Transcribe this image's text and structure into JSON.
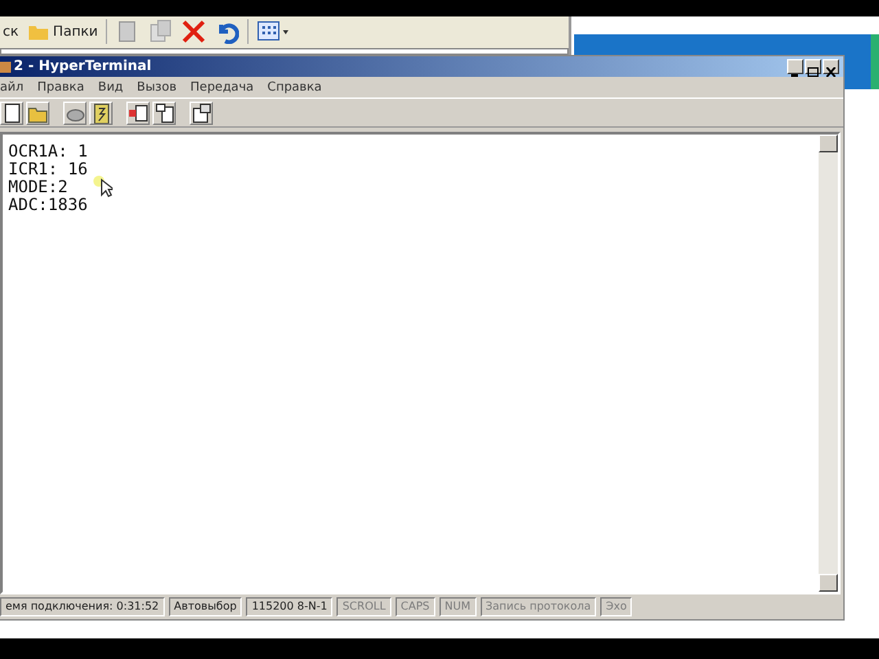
{
  "background_window": {
    "toolbar": [
      {
        "kind": "text",
        "label": "ск"
      },
      {
        "kind": "folders",
        "label": "Папки"
      },
      {
        "kind": "move"
      },
      {
        "kind": "copy"
      },
      {
        "kind": "delete"
      },
      {
        "kind": "undo"
      },
      {
        "kind": "views"
      }
    ]
  },
  "window": {
    "title": "2 - HyperTerminal"
  },
  "menu": [
    "айл",
    "Правка",
    "Вид",
    "Вызов",
    "Передача",
    "Справка"
  ],
  "toolbar": [
    {
      "kind": "new"
    },
    {
      "kind": "open"
    },
    {
      "kind": "disconnect"
    },
    {
      "kind": "dial"
    },
    {
      "kind": "send"
    },
    {
      "kind": "receive"
    },
    {
      "kind": "properties"
    }
  ],
  "terminal": {
    "lines": [
      "OCR1A: 1",
      "ICR1: 16",
      "MODE:2",
      "ADC:1836"
    ]
  },
  "status_bar": [
    {
      "text": "емя подключения: 0:31:52",
      "enabled": true
    },
    {
      "text": "Автовыбор",
      "enabled": true
    },
    {
      "text": "115200 8-N-1",
      "enabled": true
    },
    {
      "text": "SCROLL",
      "enabled": false
    },
    {
      "text": "CAPS",
      "enabled": false
    },
    {
      "text": "NUM",
      "enabled": false
    },
    {
      "text": "Запись протокола",
      "enabled": false
    },
    {
      "text": "Эхо",
      "enabled": false
    }
  ]
}
